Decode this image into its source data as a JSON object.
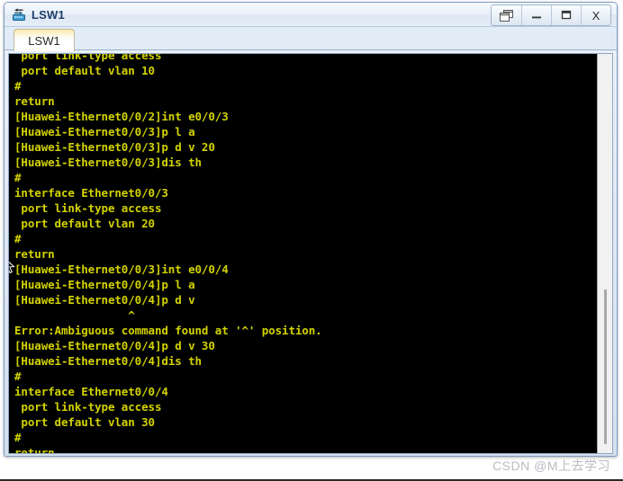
{
  "window": {
    "title": "LSW1",
    "icon": "switch-icon",
    "controls": [
      {
        "name": "restore-window-button",
        "icon": "restore-icon",
        "label": ""
      },
      {
        "name": "minimize-window-button",
        "icon": "minimize-icon",
        "label": "–"
      },
      {
        "name": "maximize-window-button",
        "icon": "maximize-icon",
        "label": ""
      },
      {
        "name": "close-window-button",
        "icon": "close-icon",
        "label": "X"
      }
    ]
  },
  "tabs": [
    {
      "label": "LSW1",
      "active": true
    }
  ],
  "terminal": {
    "foreground_color": "#d2d200",
    "background_color": "#000000",
    "cursor": "block",
    "lines": [
      " port link-type access",
      " port default vlan 10",
      "#",
      "return",
      "[Huawei-Ethernet0/0/2]int e0/0/3",
      "[Huawei-Ethernet0/0/3]p l a",
      "[Huawei-Ethernet0/0/3]p d v 20",
      "[Huawei-Ethernet0/0/3]dis th",
      "#",
      "interface Ethernet0/0/3",
      " port link-type access",
      " port default vlan 20",
      "#",
      "return",
      "[Huawei-Ethernet0/0/3]int e0/0/4",
      "[Huawei-Ethernet0/0/4]p l a",
      "[Huawei-Ethernet0/0/4]p d v",
      "                 ^",
      "Error:Ambiguous command found at '^' position.",
      "[Huawei-Ethernet0/0/4]p d v 30",
      "[Huawei-Ethernet0/0/4]dis th",
      "#",
      "interface Ethernet0/0/4",
      " port link-type access",
      " port default vlan 30",
      "#",
      "return"
    ],
    "prompt_line": "[Huawei-Ethernet0/0/4]"
  },
  "scrollbar": {
    "orientation": "vertical",
    "thumb_position_percent": 60
  },
  "watermark": {
    "text": "CSDN @M上去学习"
  }
}
